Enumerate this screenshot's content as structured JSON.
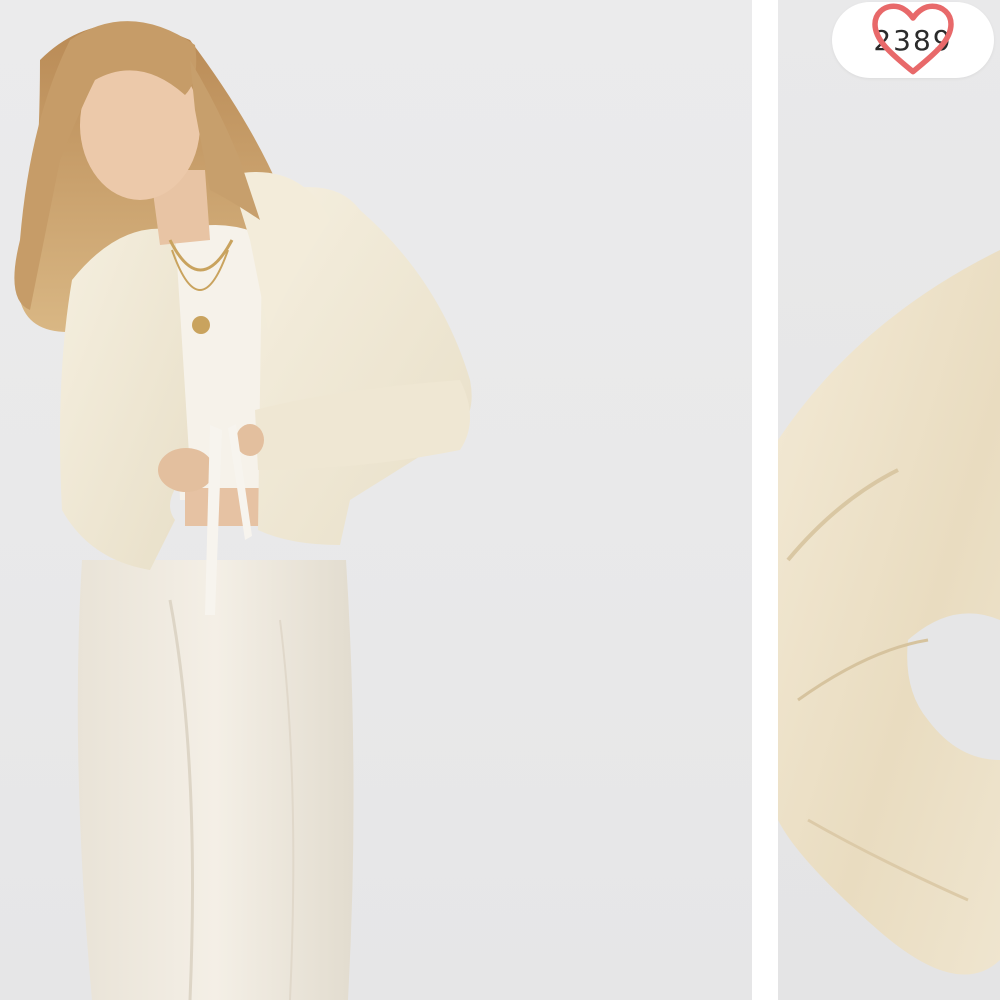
{
  "product_gallery": {
    "images": [
      {
        "name": "model-full-outfit"
      },
      {
        "name": "sleeve-detail"
      }
    ]
  },
  "like_button": {
    "count": "2389",
    "icon": "heart-outline-icon",
    "accent_color": "#e8696a"
  }
}
